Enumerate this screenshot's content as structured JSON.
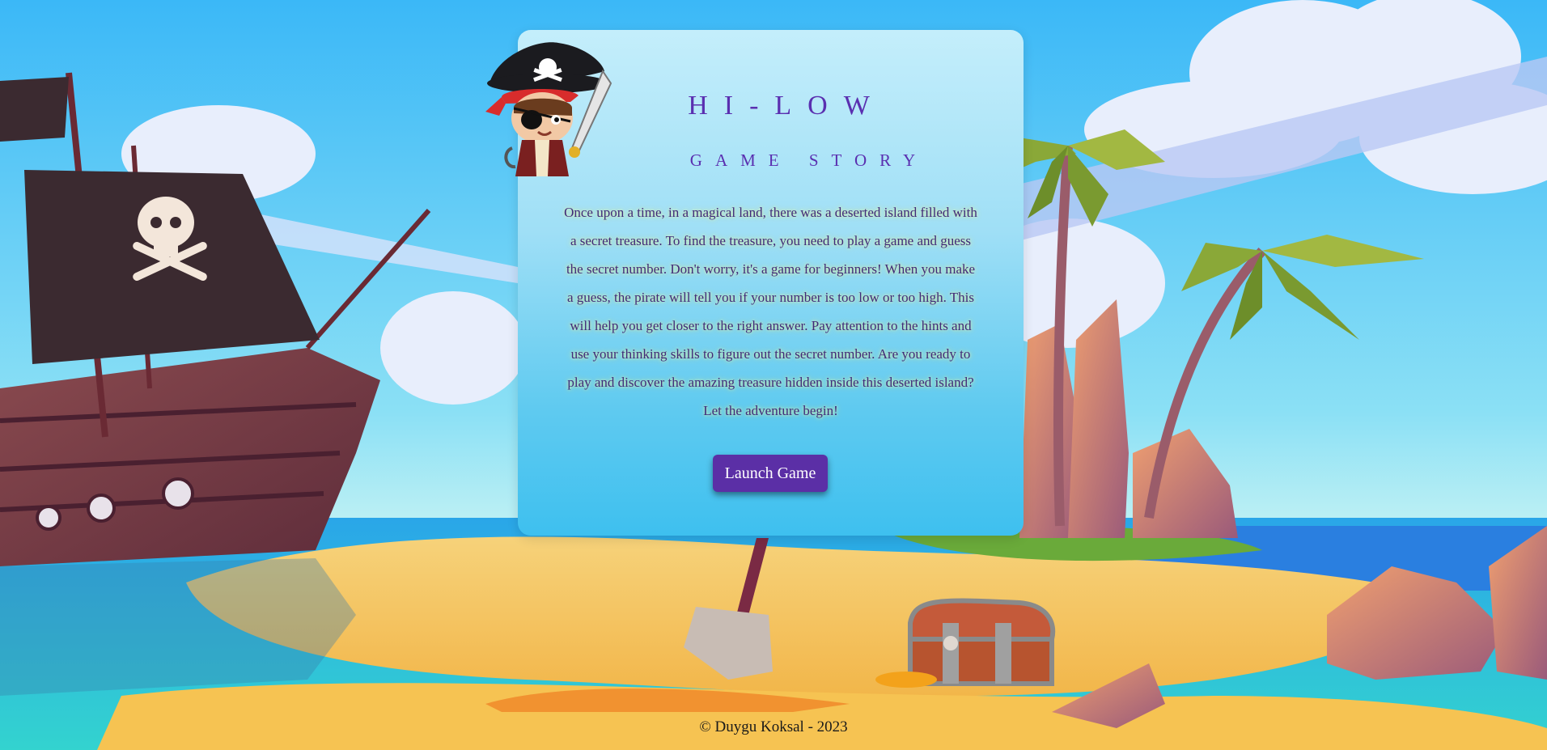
{
  "game": {
    "title": "HI-LOW",
    "subtitle": "GAME STORY"
  },
  "story": {
    "text": "Once upon a time, in a magical land, there was a deserted island filled with a secret treasure. To find the treasure, you need to play a game and guess the secret number. Don't worry, it's a game for beginners! When you make a guess, the pirate will tell you if your number is too low or too high. This will help you get closer to the right answer. Pay attention to the hints and use your thinking skills to figure out the secret number. Are you ready to play and discover the amazing treasure hidden inside this deserted island? Let the adventure begin!"
  },
  "actions": {
    "launch_label": "Launch Game"
  },
  "footer": {
    "copyright": "© Duygu Koksal - 2023"
  },
  "colors": {
    "accent": "#5b2fa6",
    "title": "#5a2fb0",
    "sky": "#4cc2f5",
    "sand": "#f7c95a",
    "sea": "#35c9d6"
  },
  "icons": {
    "pirate": "pirate-mascot-icon",
    "ship": "pirate-ship-icon",
    "chest": "treasure-chest-icon",
    "shovel": "shovel-icon",
    "palm": "palm-tree-icon"
  }
}
